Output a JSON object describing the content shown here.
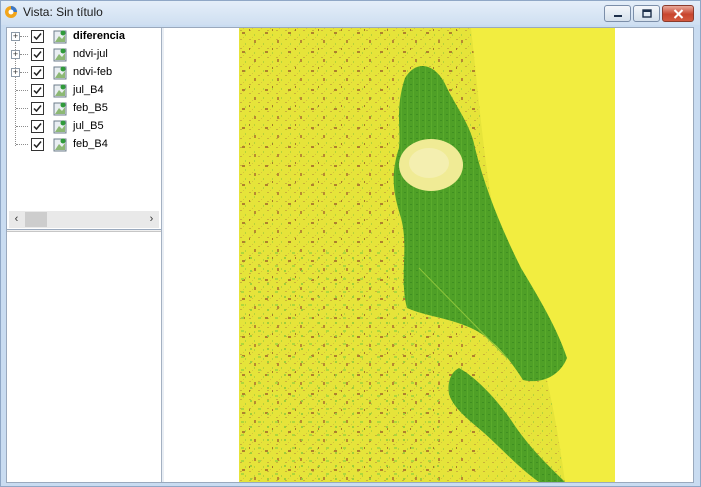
{
  "window": {
    "title": "Vista: Sin título"
  },
  "toc": {
    "layers": [
      {
        "name": "diferencia",
        "checked": true,
        "expandable": true,
        "bold": true
      },
      {
        "name": "ndvi-jul",
        "checked": true,
        "expandable": true,
        "bold": false
      },
      {
        "name": "ndvi-feb",
        "checked": true,
        "expandable": true,
        "bold": false
      },
      {
        "name": "jul_B4",
        "checked": true,
        "expandable": false,
        "bold": false
      },
      {
        "name": "feb_B5",
        "checked": true,
        "expandable": false,
        "bold": false
      },
      {
        "name": "jul_B5",
        "checked": true,
        "expandable": false,
        "bold": false
      },
      {
        "name": "feb_B4",
        "checked": true,
        "expandable": false,
        "bold": false
      }
    ],
    "scroll_left_glyph": "‹",
    "scroll_right_glyph": "›"
  },
  "colors": {
    "raster_yellow": "#e8e83a",
    "raster_green": "#4a9e25",
    "raster_light_green": "#9fd03a",
    "raster_brown": "#a6702c",
    "sea_yellow": "#f3ee3f"
  },
  "icons": {
    "app": "gvsig-app-icon",
    "layer": "raster-layer-icon",
    "minimize": "minimize-icon",
    "maximize": "maximize-icon",
    "close": "close-icon"
  }
}
